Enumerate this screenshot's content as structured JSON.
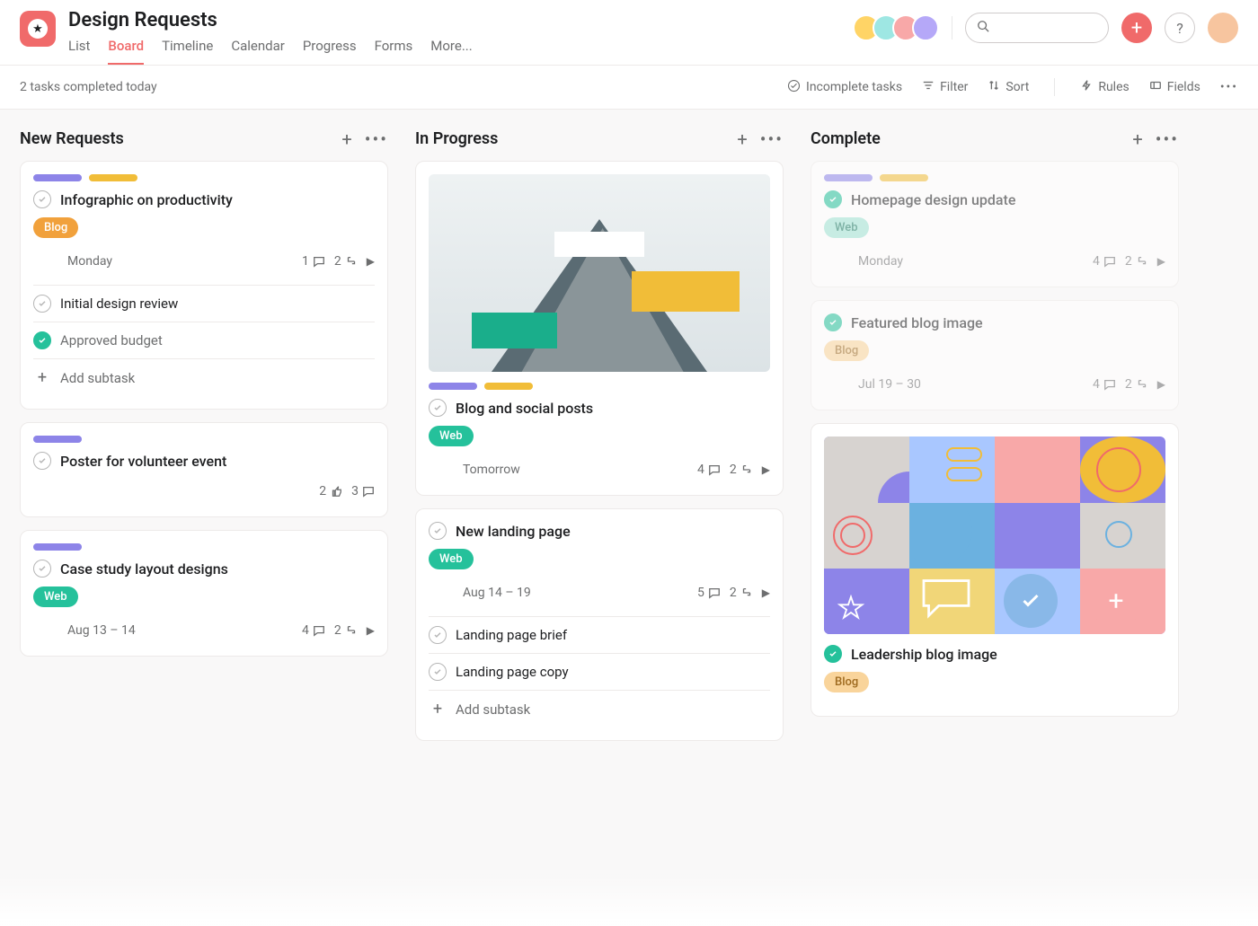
{
  "header": {
    "title": "Design Requests",
    "tabs": [
      "List",
      "Board",
      "Timeline",
      "Calendar",
      "Progress",
      "Forms",
      "More..."
    ],
    "active_tab": "Board"
  },
  "toolbar": {
    "status": "2 tasks completed today",
    "incomplete": "Incomplete tasks",
    "filter": "Filter",
    "sort": "Sort",
    "rules": "Rules",
    "fields": "Fields"
  },
  "columns": [
    {
      "title": "New Requests",
      "cards": [
        {
          "pills": [
            "purple",
            "yellow"
          ],
          "title": "Infographic on productivity",
          "tag": {
            "label": "Blog",
            "style": "blog"
          },
          "assignee": true,
          "due": "Monday",
          "meta": {
            "comments": 1,
            "subtasks": 2
          },
          "subtasks": [
            {
              "done": false,
              "label": "Initial design review"
            },
            {
              "done": true,
              "label": "Approved budget"
            }
          ],
          "add_subtask": "Add subtask"
        },
        {
          "pills": [
            "purple"
          ],
          "title": "Poster for volunteer event",
          "assignee": true,
          "meta": {
            "likes": 2,
            "comments": 3
          }
        },
        {
          "pills": [
            "purple"
          ],
          "title": "Case study layout designs",
          "tag": {
            "label": "Web",
            "style": "web"
          },
          "assignee": true,
          "due": "Aug 13 – 14",
          "meta": {
            "comments": 4,
            "subtasks": 2
          }
        }
      ]
    },
    {
      "title": "In Progress",
      "cards": [
        {
          "cover": "mountain",
          "pills": [
            "purple",
            "yellow"
          ],
          "title": "Blog and social posts",
          "tag": {
            "label": "Web",
            "style": "web"
          },
          "assignee": true,
          "due": "Tomorrow",
          "meta": {
            "comments": 4,
            "subtasks": 2
          }
        },
        {
          "title": "New landing page",
          "tag": {
            "label": "Web",
            "style": "web"
          },
          "assignee": true,
          "due": "Aug 14 – 19",
          "meta": {
            "comments": 5,
            "subtasks": 2
          },
          "subtasks": [
            {
              "done": false,
              "label": "Landing page brief"
            },
            {
              "done": false,
              "label": "Landing page copy"
            }
          ],
          "add_subtask": "Add subtask"
        }
      ]
    },
    {
      "title": "Complete",
      "cards": [
        {
          "faded": true,
          "pills": [
            "purple",
            "yellow"
          ],
          "done": true,
          "title": "Homepage design update",
          "tag": {
            "label": "Web",
            "style": "web-light"
          },
          "assignee": true,
          "due": "Monday",
          "meta": {
            "comments": 4,
            "subtasks": 2
          }
        },
        {
          "faded": true,
          "done": true,
          "title": "Featured blog image",
          "tag": {
            "label": "Blog",
            "style": "blog-light"
          },
          "assignee": true,
          "due": "Jul 19 – 30",
          "meta": {
            "comments": 4,
            "subtasks": 2
          }
        },
        {
          "cover": "abstract",
          "done": true,
          "title": "Leadership blog image",
          "tag": {
            "label": "Blog",
            "style": "blog-light"
          }
        }
      ]
    }
  ]
}
